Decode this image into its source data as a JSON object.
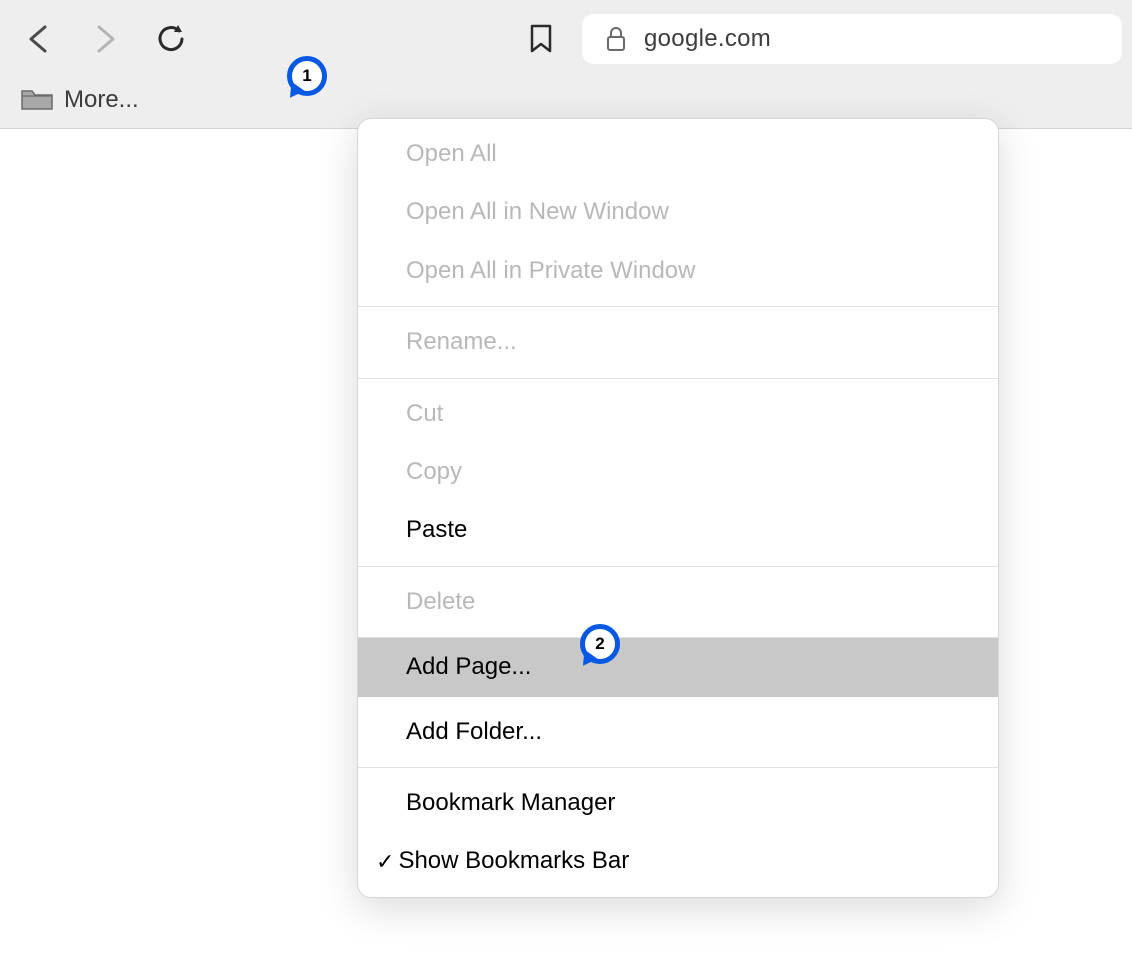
{
  "toolbar": {
    "address": "google.com"
  },
  "bookmarks_bar": {
    "more_label": "More..."
  },
  "context_menu": {
    "open_all": "Open All",
    "open_all_new_window": "Open All in New Window",
    "open_all_private_window": "Open All in Private Window",
    "rename": "Rename...",
    "cut": "Cut",
    "copy": "Copy",
    "paste": "Paste",
    "delete": "Delete",
    "add_page": "Add Page...",
    "add_folder": "Add Folder...",
    "bookmark_manager": "Bookmark Manager",
    "show_bookmarks_bar": "Show Bookmarks Bar"
  },
  "annotations": {
    "marker_1": "1",
    "marker_2": "2"
  }
}
